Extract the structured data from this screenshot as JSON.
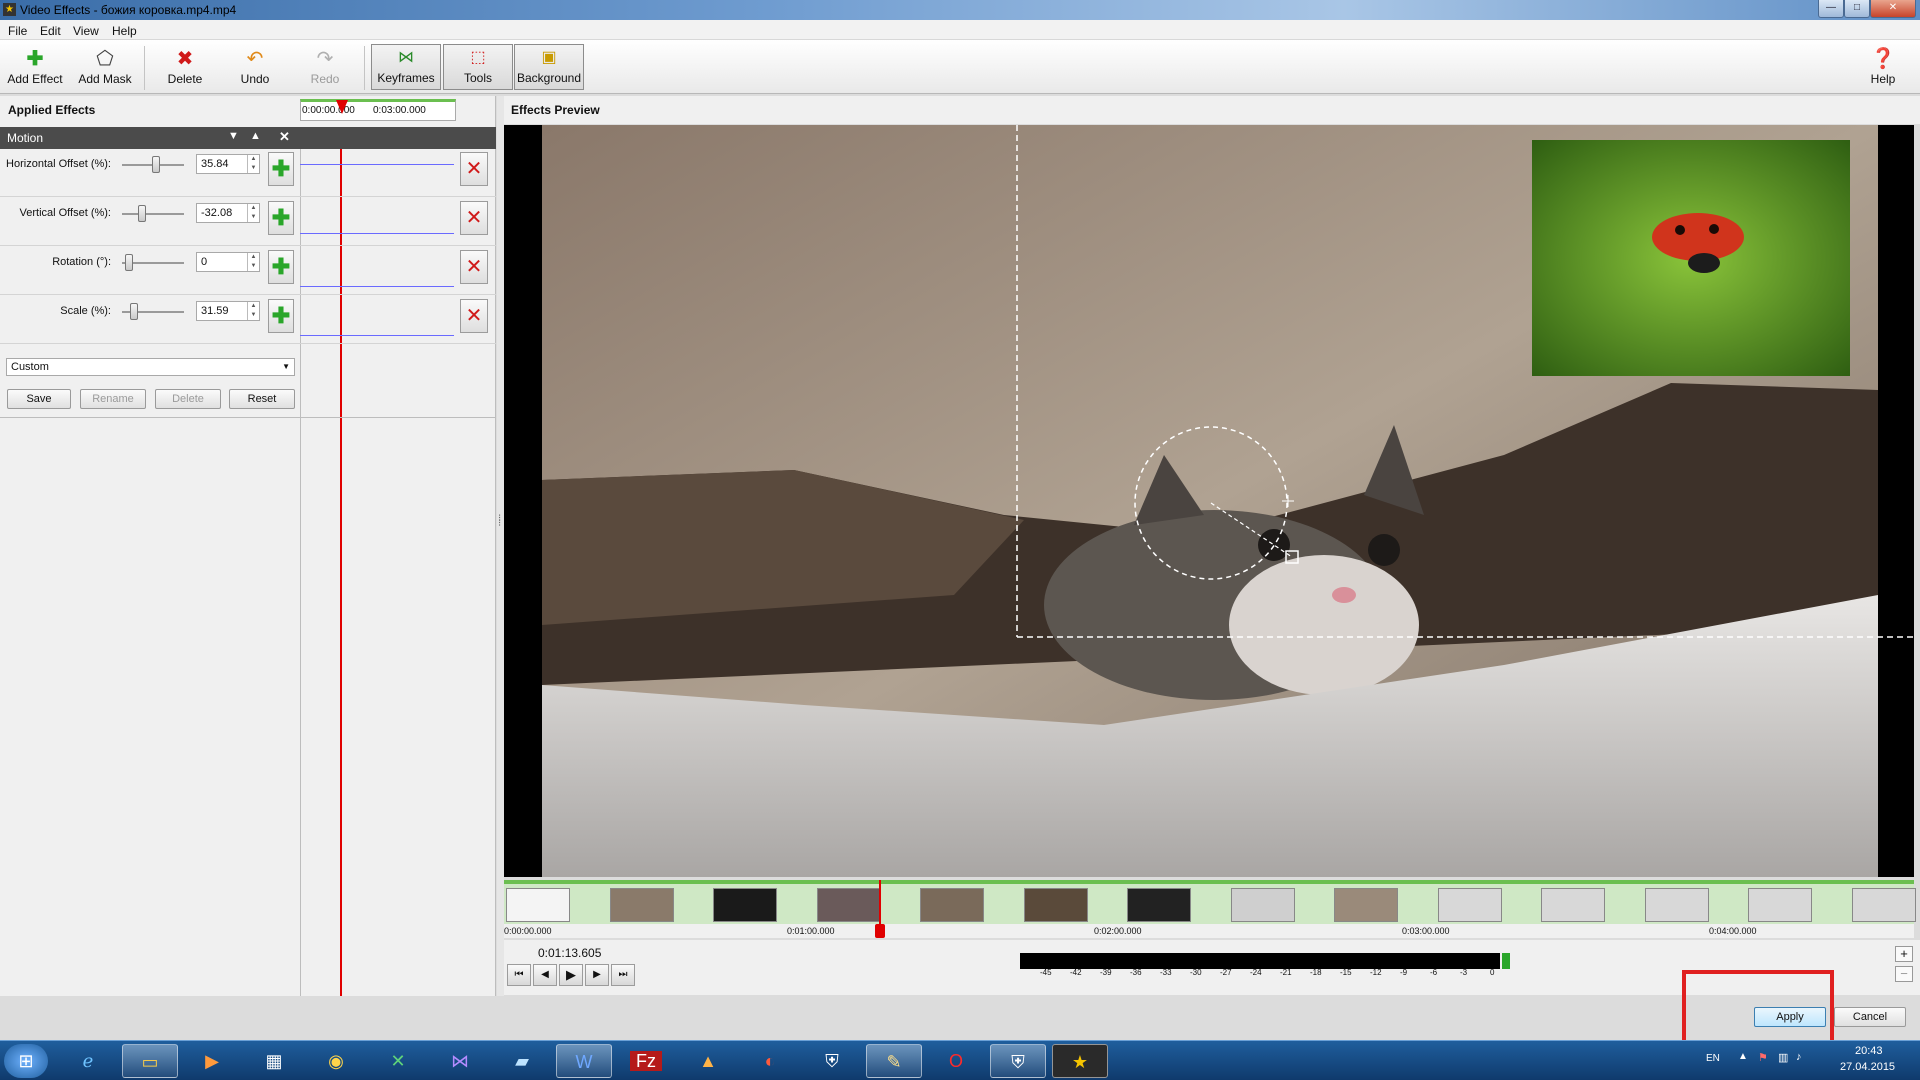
{
  "window": {
    "title": "Video Effects - божия коровка.mp4.mp4",
    "min": "—",
    "max": "□",
    "close": "✕"
  },
  "menu": [
    "File",
    "Edit",
    "View",
    "Help"
  ],
  "toolbar": {
    "add_effect": "Add Effect",
    "add_mask": "Add Mask",
    "delete": "Delete",
    "undo": "Undo",
    "redo": "Redo",
    "keyframes": "Keyframes",
    "tools": "Tools",
    "background": "Background",
    "help": "Help"
  },
  "applied_effects": {
    "header": "Applied Effects",
    "ruler_start": "0:00:00.000",
    "ruler_end": "0:03:00.000",
    "effect_name": "Motion",
    "params": [
      {
        "label": "Horizontal Offset (%):",
        "value": "35.84",
        "level": 0.55
      },
      {
        "label": "Vertical Offset (%):",
        "value": "-32.08",
        "level": 0.3
      },
      {
        "label": "Rotation (°):",
        "value": "0",
        "level": 0.05
      },
      {
        "label": "Scale (%):",
        "value": "31.59",
        "level": 0.15
      }
    ],
    "preset": "Custom",
    "buttons": {
      "save": "Save",
      "rename": "Rename",
      "delete": "Delete",
      "reset": "Reset"
    }
  },
  "preview": {
    "header": "Effects Preview",
    "time_labels": [
      "0:00:00.000",
      "0:01:00.000",
      "0:02:00.000",
      "0:03:00.000",
      "0:04:00.000"
    ],
    "current_time": "0:01:13.605",
    "meter_ticks": [
      "-45",
      "-42",
      "-39",
      "-36",
      "-33",
      "-30",
      "-27",
      "-24",
      "-21",
      "-18",
      "-15",
      "-12",
      "-9",
      "-6",
      "-3",
      "0"
    ]
  },
  "transport": {
    "first": "⏮",
    "prev": "◀",
    "play": "▶",
    "next": "▶",
    "last": "⏭"
  },
  "zoom": {
    "in": "+",
    "out": "−"
  },
  "dialog": {
    "apply": "Apply",
    "cancel": "Cancel"
  },
  "taskbar": {
    "time": "20:43",
    "date": "27.04.2015",
    "lang": "EN"
  },
  "colors": {
    "accent": "#6bbf50",
    "playhead": "#e00000",
    "highlight": "#e02020"
  }
}
